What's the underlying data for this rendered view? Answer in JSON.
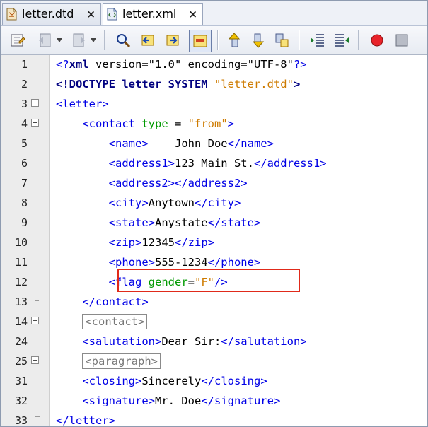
{
  "tabs": [
    {
      "label": "letter.dtd",
      "close": "×",
      "icon": "dtd-file-icon"
    },
    {
      "label": "letter.xml",
      "close": "×",
      "icon": "xml-file-icon"
    }
  ],
  "toolbar": {
    "buttons": [
      "last-edit-icon",
      "back-icon",
      "forward-icon",
      "find-selection-icon",
      "find-previous-icon",
      "find-next-icon",
      "toggle-highlight-icon",
      "previous-bookmark-icon",
      "next-bookmark-icon",
      "toggle-bookmark-icon",
      "shift-left-icon",
      "shift-right-icon",
      "start-macro-icon",
      "stop-macro-icon"
    ]
  },
  "editor": {
    "lines": [
      {
        "num": "1",
        "fold": "",
        "segments": [
          {
            "cls": "tag",
            "t": "<?"
          },
          {
            "cls": "kw",
            "t": "xml"
          },
          {
            "cls": "",
            "t": " version=\"1.0\" encoding=\"UTF-8\""
          },
          {
            "cls": "tag",
            "t": "?>"
          }
        ]
      },
      {
        "num": "2",
        "fold": "",
        "segments": [
          {
            "cls": "kw",
            "t": "<!DOCTYPE letter SYSTEM "
          },
          {
            "cls": "val",
            "t": "\"letter.dtd\""
          },
          {
            "cls": "kw",
            "t": ">"
          }
        ]
      },
      {
        "num": "3",
        "fold": "−",
        "segments": [
          {
            "cls": "tag",
            "t": "<letter>"
          }
        ]
      },
      {
        "num": "4",
        "fold": "−",
        "segments": [
          {
            "cls": "tag",
            "t": "    <contact "
          },
          {
            "cls": "attr",
            "t": "type"
          },
          {
            "cls": "",
            "t": " = "
          },
          {
            "cls": "val",
            "t": "\"from\""
          },
          {
            "cls": "tag",
            "t": ">"
          }
        ]
      },
      {
        "num": "5",
        "fold": "",
        "segments": [
          {
            "cls": "tag",
            "t": "        <name>"
          },
          {
            "cls": "",
            "t": "    John Doe"
          },
          {
            "cls": "tag",
            "t": "</name>"
          }
        ]
      },
      {
        "num": "6",
        "fold": "",
        "segments": [
          {
            "cls": "tag",
            "t": "        <address1>"
          },
          {
            "cls": "",
            "t": "123 Main St."
          },
          {
            "cls": "tag",
            "t": "</address1>"
          }
        ]
      },
      {
        "num": "7",
        "fold": "",
        "segments": [
          {
            "cls": "tag",
            "t": "        <address2></address2>"
          }
        ]
      },
      {
        "num": "8",
        "fold": "",
        "segments": [
          {
            "cls": "tag",
            "t": "        <city>"
          },
          {
            "cls": "",
            "t": "Anytown"
          },
          {
            "cls": "tag",
            "t": "</city>"
          }
        ]
      },
      {
        "num": "9",
        "fold": "",
        "segments": [
          {
            "cls": "tag",
            "t": "        <state>"
          },
          {
            "cls": "",
            "t": "Anystate"
          },
          {
            "cls": "tag",
            "t": "</state>"
          }
        ]
      },
      {
        "num": "10",
        "fold": "",
        "segments": [
          {
            "cls": "tag",
            "t": "        <zip>"
          },
          {
            "cls": "",
            "t": "12345"
          },
          {
            "cls": "tag",
            "t": "</zip>"
          }
        ]
      },
      {
        "num": "11",
        "fold": "",
        "segments": [
          {
            "cls": "tag",
            "t": "        <phone>"
          },
          {
            "cls": "",
            "t": "555-1234"
          },
          {
            "cls": "tag",
            "t": "</phone>"
          }
        ]
      },
      {
        "num": "12",
        "fold": "",
        "segments": [
          {
            "cls": "tag",
            "t": "        <flag "
          },
          {
            "cls": "attr",
            "t": "gender"
          },
          {
            "cls": "",
            "t": "="
          },
          {
            "cls": "val",
            "t": "\"F\""
          },
          {
            "cls": "tag",
            "t": "/>"
          }
        ]
      },
      {
        "num": "13",
        "fold": "",
        "segments": [
          {
            "cls": "tag",
            "t": "    </contact>"
          }
        ]
      },
      {
        "num": "14",
        "fold": "+",
        "segments": [
          {
            "cls": "",
            "t": "    "
          },
          {
            "cls": "folded",
            "t": "<contact>"
          }
        ]
      },
      {
        "num": "24",
        "fold": "",
        "segments": [
          {
            "cls": "tag",
            "t": "    <salutation>"
          },
          {
            "cls": "",
            "t": "Dear Sir:"
          },
          {
            "cls": "tag",
            "t": "</salutation>"
          }
        ]
      },
      {
        "num": "25",
        "fold": "+",
        "segments": [
          {
            "cls": "",
            "t": "    "
          },
          {
            "cls": "folded",
            "t": "<paragraph>"
          }
        ]
      },
      {
        "num": "31",
        "fold": "",
        "segments": [
          {
            "cls": "tag",
            "t": "    <closing>"
          },
          {
            "cls": "",
            "t": "Sincerely"
          },
          {
            "cls": "tag",
            "t": "</closing>"
          }
        ]
      },
      {
        "num": "32",
        "fold": "",
        "segments": [
          {
            "cls": "tag",
            "t": "    <signature>"
          },
          {
            "cls": "",
            "t": "Mr. Doe"
          },
          {
            "cls": "tag",
            "t": "</signature>"
          }
        ]
      },
      {
        "num": "33",
        "fold": "",
        "segments": [
          {
            "cls": "tag",
            "t": "</letter>"
          }
        ]
      }
    ],
    "highlight_color": "#e02a1a"
  }
}
